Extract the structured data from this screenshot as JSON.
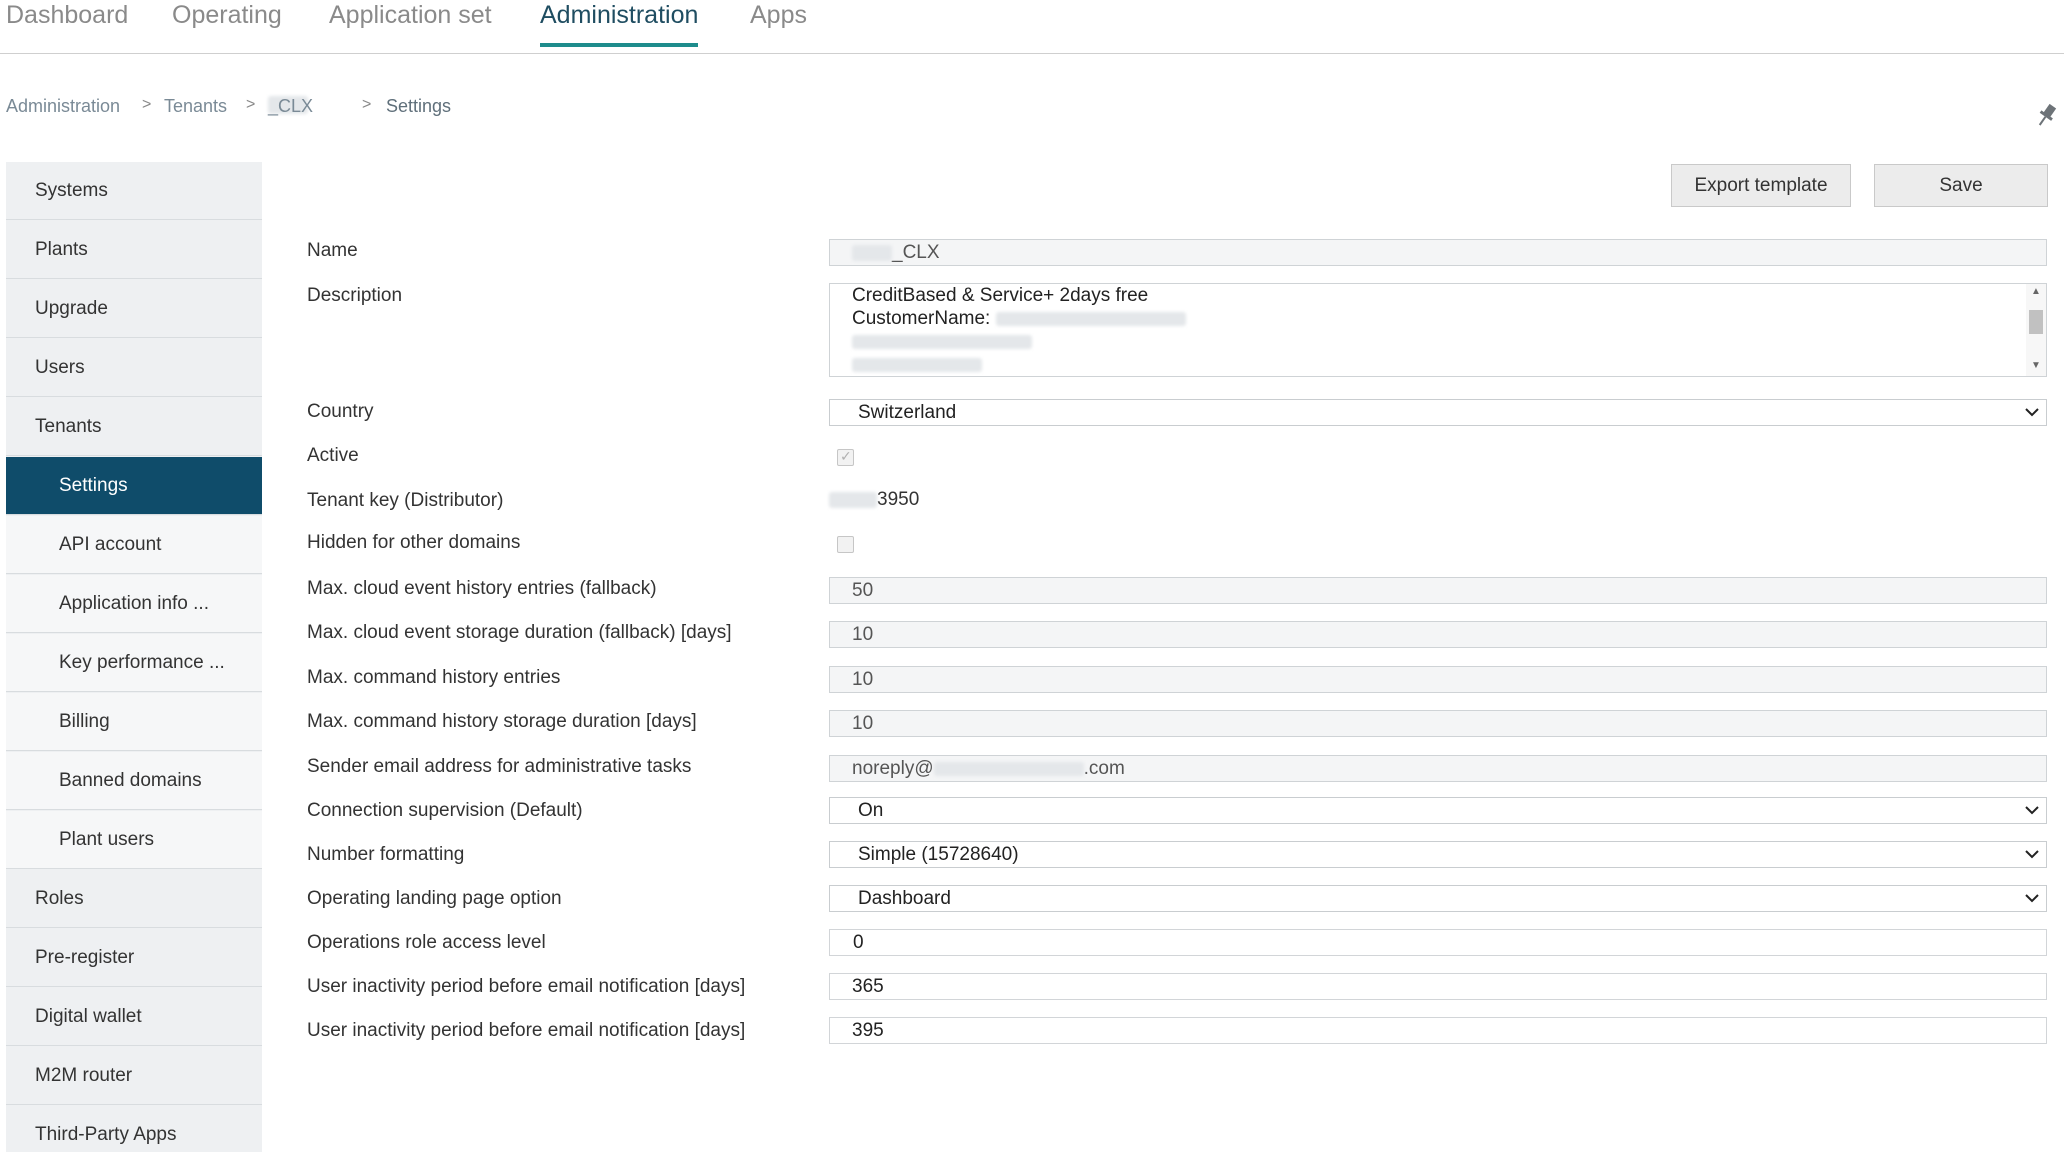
{
  "topnav": {
    "tabs": [
      {
        "label": "Dashboard"
      },
      {
        "label": "Operating"
      },
      {
        "label": "Application set"
      },
      {
        "label": "Administration"
      },
      {
        "label": "Apps"
      }
    ]
  },
  "breadcrumb": {
    "items": [
      "Administration",
      "Tenants",
      "_CLX",
      "Settings"
    ],
    "separator": ">"
  },
  "toolbar": {
    "export_label": "Export template",
    "save_label": "Save"
  },
  "sidebar": {
    "items": [
      {
        "label": "Systems"
      },
      {
        "label": "Plants"
      },
      {
        "label": "Upgrade"
      },
      {
        "label": "Users"
      },
      {
        "label": "Tenants"
      },
      {
        "label": "Settings"
      },
      {
        "label": "API account"
      },
      {
        "label": "Application info ..."
      },
      {
        "label": "Key performance ..."
      },
      {
        "label": "Billing"
      },
      {
        "label": "Banned domains"
      },
      {
        "label": "Plant users"
      },
      {
        "label": "Roles"
      },
      {
        "label": "Pre-register"
      },
      {
        "label": "Digital wallet"
      },
      {
        "label": "M2M router"
      },
      {
        "label": "Third-Party Apps"
      }
    ]
  },
  "form": {
    "name": {
      "label": "Name",
      "value": "_CLX"
    },
    "description": {
      "label": "Description",
      "line1": "CreditBased & Service+ 2days free",
      "line2": "CustomerName:"
    },
    "country": {
      "label": "Country",
      "value": "Switzerland"
    },
    "active": {
      "label": "Active",
      "checked": true
    },
    "tenant_key": {
      "label": "Tenant key (Distributor)",
      "value": "3950"
    },
    "hidden_domains": {
      "label": "Hidden for other domains",
      "checked": false
    },
    "max_cloud_event_entries": {
      "label": "Max. cloud event history entries (fallback)",
      "value": "50"
    },
    "max_cloud_event_duration": {
      "label": "Max. cloud event storage duration (fallback) [days]",
      "value": "10"
    },
    "max_command_entries": {
      "label": "Max. command history entries",
      "value": "10"
    },
    "max_command_duration": {
      "label": "Max. command history storage duration [days]",
      "value": "10"
    },
    "sender_email": {
      "label": "Sender email address for administrative tasks",
      "prefix": "noreply@",
      "suffix": ".com"
    },
    "connection_supervision": {
      "label": "Connection supervision (Default)",
      "value": "On"
    },
    "number_formatting": {
      "label": "Number formatting",
      "value": "Simple (15728640)"
    },
    "landing_page": {
      "label": "Operating landing page option",
      "value": "Dashboard"
    },
    "ops_role_level": {
      "label": "Operations role access level",
      "value": "0"
    },
    "inactivity_1": {
      "label": "User inactivity period before email notification [days]",
      "value": "365"
    },
    "inactivity_2": {
      "label": "User inactivity period before email notification [days]",
      "value": "395"
    }
  },
  "icons": {
    "pin": "pushpin-icon",
    "chevron": "chevron-down-icon",
    "checkmark": "checkmark-icon"
  },
  "colors": {
    "accent_underline": "#1e8c8c",
    "sidebar_active": "#0f4c6a",
    "active_tab_text": "#1f4d61"
  }
}
